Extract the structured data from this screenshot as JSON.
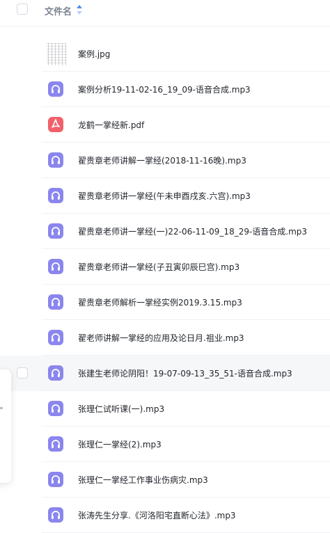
{
  "header": {
    "column_label": "文件名",
    "sort_icon": "sort-ascending-icon"
  },
  "files": [
    {
      "name": "案例.jpg",
      "type": "image",
      "icon": "image-thumbnail"
    },
    {
      "name": "案例分析19-11-02-16_19_09-语音合成.mp3",
      "type": "audio",
      "icon": "headphones-icon"
    },
    {
      "name": "龙鹤一掌经新.pdf",
      "type": "pdf",
      "icon": "pdf-icon"
    },
    {
      "name": "翟贵章老师讲解一掌经(2018-11-16晚).mp3",
      "type": "audio",
      "icon": "headphones-icon"
    },
    {
      "name": "翟贵章老师讲一掌经(午未申酉戌亥.六宫).mp3",
      "type": "audio",
      "icon": "headphones-icon"
    },
    {
      "name": "翟贵章老师讲一掌经(一)22-06-11-09_18_29-语音合成.mp3",
      "type": "audio",
      "icon": "headphones-icon"
    },
    {
      "name": "翟贵章老师讲一掌经(子丑寅卯辰巳宫).mp3",
      "type": "audio",
      "icon": "headphones-icon"
    },
    {
      "name": "翟贵章老师解析一掌经实例2019.3.15.mp3",
      "type": "audio",
      "icon": "headphones-icon"
    },
    {
      "name": "翟老师讲解一掌经的应用及论日月.祖业.mp3",
      "type": "audio",
      "icon": "headphones-icon"
    },
    {
      "name": "张建生老师论阴阳！19-07-09-13_35_51-语音合成.mp3",
      "type": "audio",
      "icon": "headphones-icon"
    },
    {
      "name": "张理仁试听课(一).mp3",
      "type": "audio",
      "icon": "headphones-icon"
    },
    {
      "name": "张理仁一掌经(2).mp3",
      "type": "audio",
      "icon": "headphones-icon"
    },
    {
      "name": "张理仁一掌经工作事业伤病灾.mp3",
      "type": "audio",
      "icon": "headphones-icon"
    },
    {
      "name": "张涛先生分享.《河洛阳宅直断心法》.mp3",
      "type": "audio",
      "icon": "headphones-icon"
    }
  ],
  "colors": {
    "audio_icon": "#8b86ee",
    "pdf_icon": "#f0616b",
    "header_text": "#7b8291",
    "hover_row": "#f6f7f9"
  }
}
